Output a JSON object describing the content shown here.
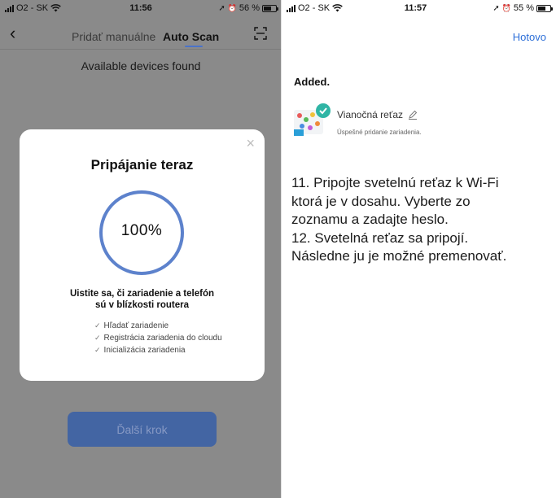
{
  "left": {
    "status": {
      "carrier": "O2 - SK",
      "time": "11:56",
      "battery": "56 %"
    },
    "nav": {
      "tab_manual": "Pridať manuálne",
      "tab_auto": "Auto Scan"
    },
    "found_text": "Available devices found",
    "modal": {
      "title": "Pripájanie teraz",
      "progress_percent": 100,
      "progress_label": "100%",
      "hint_line1": "Uistite sa, či zariadenie a telefón",
      "hint_line2": "sú v blízkosti routera",
      "steps": [
        "Hľadať zariadenie",
        "Registrácia zariadenia do cloudu",
        "Inicializácia zariadenia"
      ]
    },
    "next_button": "Ďalší krok",
    "colors": {
      "overlay": "#8a8a8a",
      "accent": "#4a73c9",
      "button": "#4365a3"
    }
  },
  "right": {
    "status": {
      "carrier": "O2 - SK",
      "time": "11:57",
      "battery": "55 %"
    },
    "done_button": "Hotovo",
    "added_title": "Added.",
    "device": {
      "name": "Vianočná reťaz",
      "status": "Úspešné pridanie zariadenia.",
      "icon": "device-thumbnail-with-check"
    },
    "instructions": [
      "11. Pripojte svetelnú reťaz k Wi-Fi",
      "ktorá je v dosahu. Vyberte zo",
      "zoznamu a zadajte heslo.",
      "12. Svetelná reťaz sa pripojí.",
      "Následne ju je možné premenovať."
    ],
    "colors": {
      "link": "#2d6fd8"
    }
  }
}
